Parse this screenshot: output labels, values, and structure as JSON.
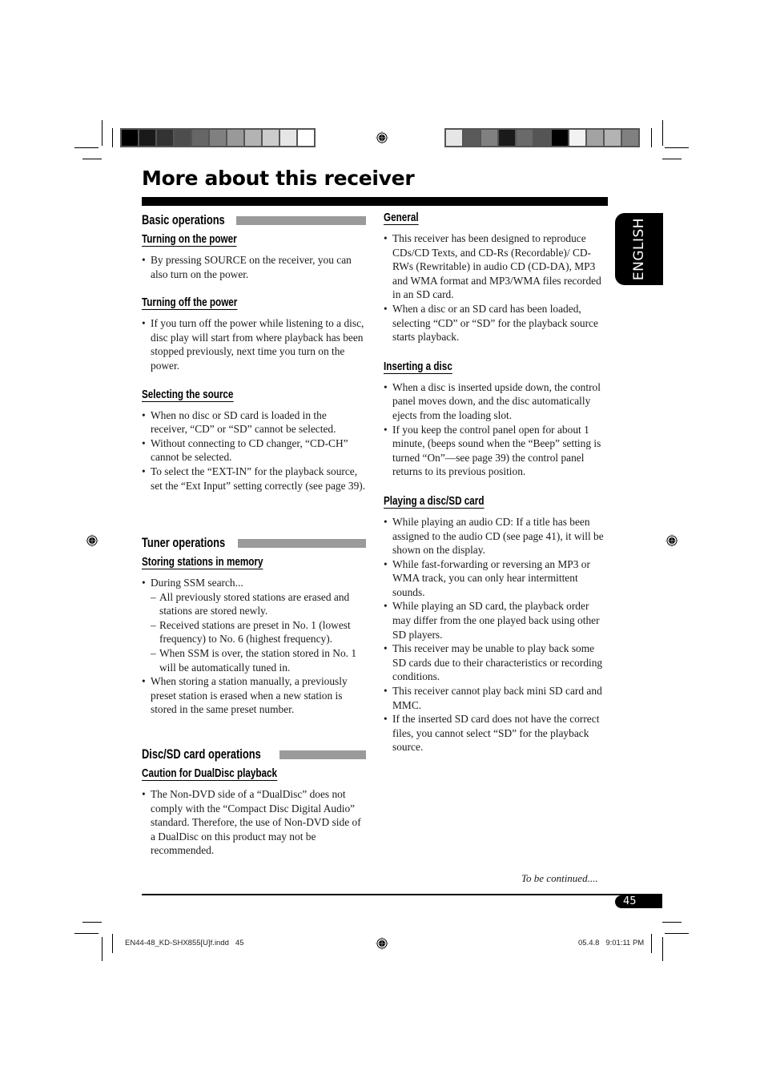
{
  "page": {
    "title": "More about this receiver",
    "language_tab": "ENGLISH",
    "continued": "To be continued....",
    "page_number": "45"
  },
  "color_bars": {
    "left": [
      "#000000",
      "#1a1a1a",
      "#333333",
      "#4d4d4d",
      "#666666",
      "#808080",
      "#999999",
      "#b3b3b3",
      "#cccccc",
      "#e6e6e6",
      "#ffffff"
    ],
    "right": [
      "#e6e6e6",
      "#5a5a5a",
      "#808080",
      "#1a1a1a",
      "#6a6a6a",
      "#555555",
      "#000000",
      "#f2f2f2",
      "#a3a3a3",
      "#b3b3b3",
      "#808080"
    ]
  },
  "left_column": {
    "basic": {
      "heading": "Basic operations",
      "turning_on": {
        "title": "Turning on the power",
        "bullets": [
          "By pressing SOURCE on the receiver, you can also turn on the power."
        ]
      },
      "turning_off": {
        "title": "Turning off the power",
        "bullets": [
          "If you turn off the power while listening to a disc, disc play will start from where playback has been stopped previously, next time you turn on the power."
        ]
      },
      "selecting": {
        "title": "Selecting the source",
        "bullets": [
          "When no disc or SD card is loaded in the receiver, “CD” or “SD” cannot be selected.",
          "Without connecting to CD changer, “CD-CH” cannot be selected.",
          "To select the “EXT-IN” for the playback source, set the “Ext Input” setting correctly (see page 39)."
        ]
      }
    },
    "tuner": {
      "heading": "Tuner operations",
      "storing": {
        "title": "Storing stations in memory",
        "bullet1": "During SSM search...",
        "dashes": [
          "All previously stored stations are erased and stations are stored newly.",
          "Received stations are preset in No. 1 (lowest frequency) to No. 6 (highest frequency).",
          "When SSM is over, the station stored in No. 1 will be automatically tuned in."
        ],
        "bullet2": "When storing a station manually, a previously preset station is erased when a new station is stored in the same preset number."
      }
    },
    "disc": {
      "heading": "Disc/SD card operations",
      "caution": {
        "title": "Caution for DualDisc playback",
        "bullets": [
          "The Non-DVD side of a “DualDisc” does not comply with the “Compact Disc Digital Audio” standard. Therefore, the use of Non-DVD side of a DualDisc on this product may not be recommended."
        ]
      }
    }
  },
  "right_column": {
    "general": {
      "title": "General",
      "bullets": [
        "This receiver has been designed to reproduce CDs/CD Texts, and CD-Rs (Recordable)/ CD-RWs (Rewritable) in audio CD (CD-DA), MP3 and WMA format and MP3/WMA files recorded in an SD card.",
        "When a disc or an SD card has been loaded, selecting “CD” or “SD” for the playback source starts playback."
      ]
    },
    "inserting": {
      "title": "Inserting a disc",
      "bullets": [
        "When a disc is inserted upside down, the control panel moves down, and the disc automatically ejects from the loading slot.",
        "If you keep the control panel open for about 1 minute, (beeps sound when the “Beep” setting is turned “On”—see page 39) the control panel returns to its previous position."
      ]
    },
    "playing": {
      "title": "Playing a disc/SD card",
      "bullets": [
        "While playing an audio CD: If a title has been assigned to the audio CD (see page 41), it will be shown on the display.",
        "While fast-forwarding or reversing an MP3 or WMA track, you can only hear intermittent sounds.",
        "While playing an SD card, the playback order may differ from the one played back using other SD players.",
        "This receiver may be unable to play back some SD cards due to their characteristics or recording conditions.",
        "This receiver cannot play back mini SD card and MMC.",
        "If the inserted SD card does not have the correct files, you cannot select “SD” for the playback source."
      ]
    }
  },
  "slug": {
    "file": "EN44-48_KD-SHX855[U]f.indd   45",
    "timestamp": "05.4.8   9:01:11 PM"
  }
}
